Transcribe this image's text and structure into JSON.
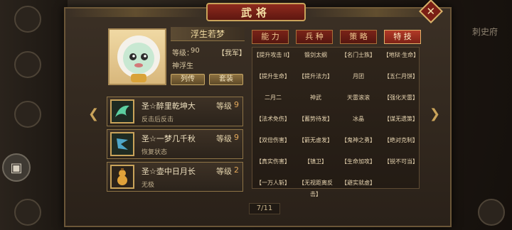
{
  "dialog": {
    "title": "武将",
    "close_label": "✕"
  },
  "general": {
    "name": "浮生若梦",
    "level_label": "等级：",
    "level_value": "90",
    "faction": "【我军】",
    "god_name": "神浮生",
    "buttons": {
      "biography": "列传",
      "outfit": "套装"
    }
  },
  "skills": [
    {
      "name": "圣☆醉里乾坤大",
      "level_label": "等级",
      "level_value": "9",
      "desc": "反击后反击"
    },
    {
      "name": "圣☆一梦几千秋",
      "level_label": "等级",
      "level_value": "9",
      "desc": "恢复状态"
    },
    {
      "name": "圣☆壶中日月长",
      "level_label": "等级",
      "level_value": "2",
      "desc": "无极"
    }
  ],
  "tabs": [
    {
      "label": "能 力"
    },
    {
      "label": "兵 种"
    },
    {
      "label": "策 略"
    },
    {
      "label": "特 技"
    }
  ],
  "traits": [
    [
      "【提升攻击 II】",
      "锻剑太纲",
      "【名门士族】",
      "【地狱·生命】"
    ],
    [
      "【提升生命】",
      "【提升法力】",
      "月团",
      "【五仁月饼】"
    ],
    [
      "二月二",
      "神武",
      "天雷滚滚",
      "【强化天雷】"
    ],
    [
      "【法术免伤】",
      "【蓄势待发】",
      "冰晶",
      "【谋无遗策】"
    ],
    [
      "【双倍伤害】",
      "【箭无虚发】",
      "【鬼神之勇】",
      "【绝对克制】"
    ],
    [
      "【真实伤害】",
      "【镇卫】",
      "【生命加攻】",
      "【锐不可当】"
    ],
    [
      "【一万人斩】",
      "【无视距离反击】",
      "【避实就虚】"
    ]
  ],
  "pager": "7/11",
  "background": {
    "right_text": "刺史府"
  }
}
